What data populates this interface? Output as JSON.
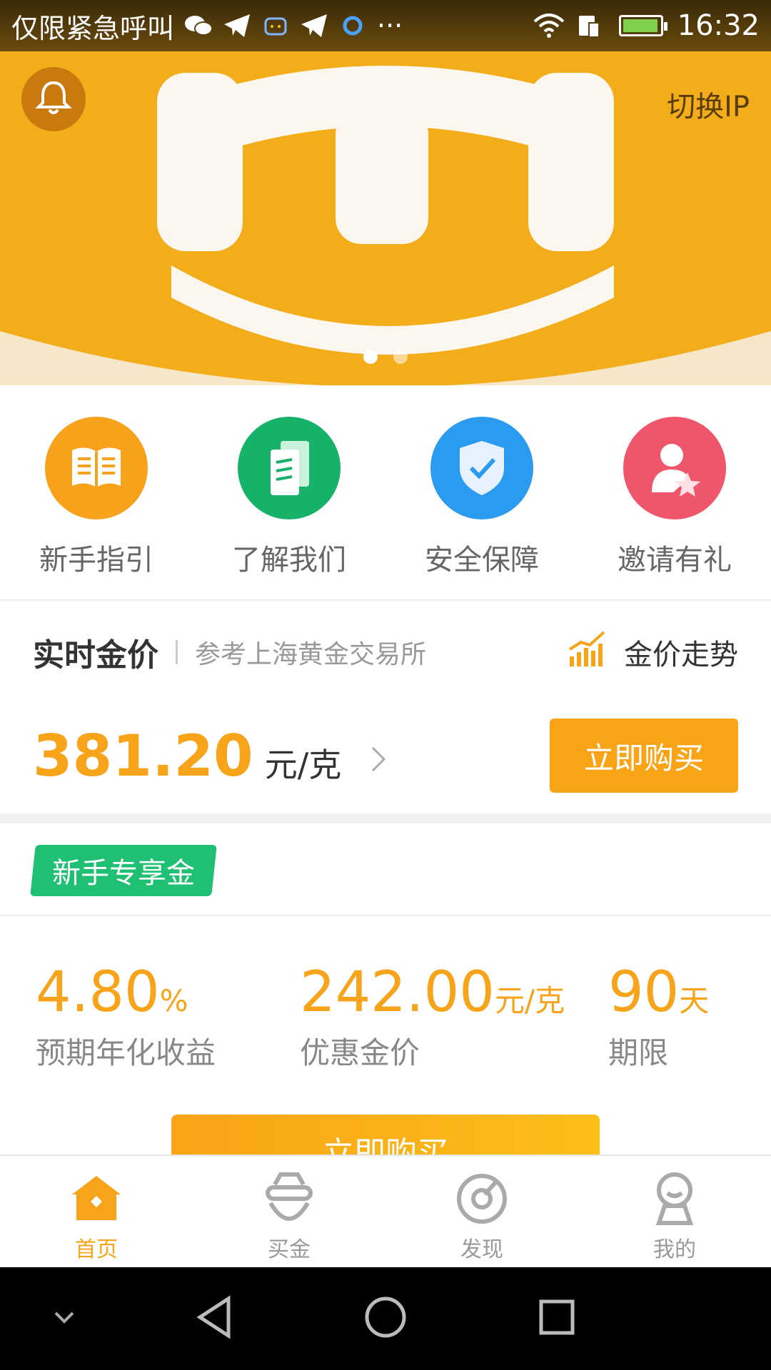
{
  "status_bar": {
    "carrier": "仅限紧急呼叫",
    "more": "···",
    "time": "16:32"
  },
  "banner": {
    "switch_ip": "切换IP",
    "dots_count": 2,
    "active_dot": 0
  },
  "quick_entries": [
    {
      "label": "新手指引",
      "icon": "book-icon",
      "color": "#f7a21a"
    },
    {
      "label": "了解我们",
      "icon": "documents-icon",
      "color": "#17b26a"
    },
    {
      "label": "安全保障",
      "icon": "shield-check-icon",
      "color": "#2b9bf0"
    },
    {
      "label": "邀请有礼",
      "icon": "user-star-icon",
      "color": "#f0566b"
    }
  ],
  "gold_price": {
    "title": "实时金价",
    "subtitle": "参考上海黄金交易所",
    "trend_label": "金价走势",
    "value": "381.20",
    "unit": "元/克",
    "buy_label": "立即购买"
  },
  "newbie": {
    "tag": "新手专享金",
    "yield_value": "4.80",
    "yield_unit": "%",
    "yield_label": "预期年化收益",
    "price_value": "242.00",
    "price_unit": "元/克",
    "price_label": "优惠金价",
    "term_value": "90",
    "term_unit": "天",
    "term_label": "期限",
    "buy_label": "立即购买"
  },
  "tabs": [
    {
      "label": "首页",
      "icon": "home-icon",
      "active": true
    },
    {
      "label": "买金",
      "icon": "buy-gold-icon",
      "active": false
    },
    {
      "label": "发现",
      "icon": "discover-icon",
      "active": false
    },
    {
      "label": "我的",
      "icon": "profile-icon",
      "active": false
    }
  ],
  "colors": {
    "accent": "#f7a41b",
    "green": "#1fbf74"
  }
}
